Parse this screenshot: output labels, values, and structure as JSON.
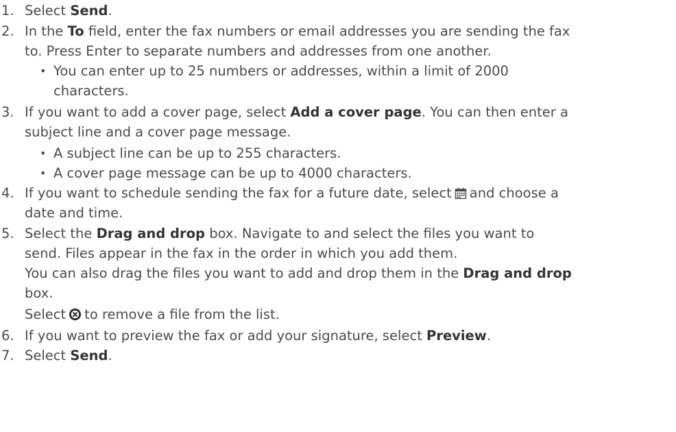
{
  "steps": [
    {
      "number": "1.",
      "pre": "Select ",
      "bold": "Send",
      "post": "."
    },
    {
      "number": "2.",
      "pre": "In the ",
      "bold": "To",
      "post": " field, enter the fax numbers or email addresses you are sending the fax",
      "cont": "to. Press Enter to separate numbers and addresses from one another.",
      "bullet": {
        "line1": "You can enter up to 25 numbers or addresses, within a limit of 2000",
        "line2": "characters."
      }
    },
    {
      "number": "3.",
      "pre": "If you want to add a cover page, select ",
      "bold": "Add a cover page",
      "post": ". You can then enter a",
      "cont": "subject line and a cover page message.",
      "bullets": [
        "A subject line can be up to 255 characters.",
        "A cover page message can be up to 4000 characters."
      ]
    },
    {
      "number": "4.",
      "pre": "If you want to schedule sending the fax for a future date, select",
      "icon": "calendar-icon",
      "post": "and choose a",
      "cont": "date and time."
    },
    {
      "number": "5.",
      "pre": "Select the ",
      "bold": "Drag and drop",
      "post": " box. Navigate to and select the files you want to",
      "cont": "send. Files appear in the fax in the order in which you add them.",
      "para1_pre": "You can also drag the files you want to add and drop them in the ",
      "para1_bold": "Drag and drop",
      "para1_end": "box.",
      "para2_pre": "Select",
      "para2_icon": "remove-file-icon",
      "para2_post": "to remove a file from the list."
    },
    {
      "number": "6.",
      "pre": "If you want to preview the fax or add your signature, select ",
      "bold": "Preview",
      "post": "."
    },
    {
      "number": "7.",
      "pre": "Select ",
      "bold": "Send",
      "post": "."
    }
  ],
  "bullet_glyph": "•"
}
